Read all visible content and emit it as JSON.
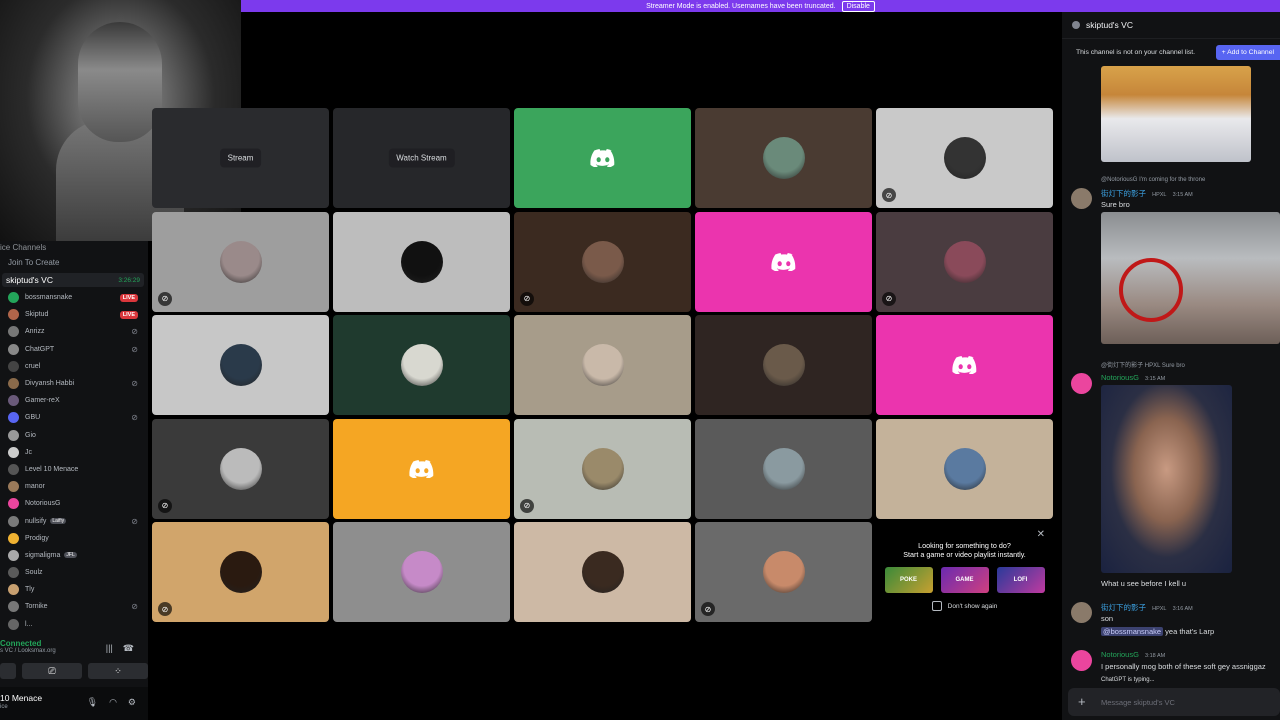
{
  "banner": {
    "text": "Streamer Mode is enabled. Usernames have been truncated.",
    "button": "Disable"
  },
  "sidebar": {
    "header": "ice Channels",
    "join": "Join To Create",
    "channel": {
      "name": "skiptud's VC",
      "timer": "3:26:29"
    },
    "members": [
      {
        "name": "bossmansnake",
        "badge": "LIVE",
        "color": "#23a55a"
      },
      {
        "name": "Skiptud",
        "badge": "LIVE",
        "color": "#b0654a"
      },
      {
        "name": "Anrizz",
        "badge": "",
        "color": "#777777",
        "muted": true
      },
      {
        "name": "ChatGPT",
        "badge": "",
        "color": "#888888",
        "muted": true
      },
      {
        "name": "cruel",
        "badge": "",
        "color": "#444444"
      },
      {
        "name": "Divyansh Habbi",
        "badge": "",
        "color": "#8a6a4a",
        "muted": true
      },
      {
        "name": "Gamer-reX",
        "badge": "",
        "color": "#6a5a7a"
      },
      {
        "name": "GBU",
        "badge": "",
        "color": "#5865f2",
        "muted": true
      },
      {
        "name": "Gio",
        "badge": "",
        "color": "#999999"
      },
      {
        "name": "Jc",
        "badge": "",
        "color": "#cccccc"
      },
      {
        "name": "Level 10 Menace",
        "badge": "",
        "color": "#555555"
      },
      {
        "name": "manor",
        "badge": "",
        "color": "#9a7a5a"
      },
      {
        "name": "NotoriousG",
        "badge": "",
        "color": "#eb459e"
      },
      {
        "name": "nullsify",
        "tag": "Laifiy",
        "badge": "",
        "color": "#7a7a7a",
        "muted": true
      },
      {
        "name": "Prodigy",
        "badge": "",
        "color": "#f0b232"
      },
      {
        "name": "sigmaligma",
        "tag": "JFL",
        "badge": "",
        "color": "#aaaaaa"
      },
      {
        "name": "Soulz",
        "badge": "",
        "color": "#5a5a5a"
      },
      {
        "name": "Tly",
        "badge": "",
        "color": "#c8a070"
      },
      {
        "name": "Tornike",
        "badge": "",
        "color": "#777777",
        "muted": true
      },
      {
        "name": "l...",
        "badge": "",
        "color": "#666666"
      }
    ],
    "connection": {
      "status": "Connected",
      "sub": "s VC / Looksmax.org"
    },
    "user": {
      "name": "10 Menace",
      "status": "ice"
    }
  },
  "tiles": [
    {
      "kind": "stream",
      "label": "Stream",
      "bg": "#2a2b2e",
      "muted": false
    },
    {
      "kind": "stream",
      "label": "Watch Stream",
      "bg": "#26272a",
      "muted": false
    },
    {
      "kind": "logo",
      "bg": "#3ba55c",
      "muted": false
    },
    {
      "kind": "avatar",
      "bg": "#4a3b32",
      "av": "#6a8a7a",
      "muted": false
    },
    {
      "kind": "avatar",
      "bg": "#c9c9c9",
      "av": "#333333",
      "muted": true
    },
    {
      "kind": "avatar",
      "bg": "#9e9e9e",
      "av": "#9a8a8a",
      "muted": true
    },
    {
      "kind": "avatar",
      "bg": "#bdbdbd",
      "av": "#111111",
      "muted": false
    },
    {
      "kind": "avatar",
      "bg": "#3b2a20",
      "av": "#7a5a4a",
      "muted": true
    },
    {
      "kind": "logo",
      "bg": "#eb34ae",
      "muted": false
    },
    {
      "kind": "avatar",
      "bg": "#4a3c40",
      "av": "#8a4a5a",
      "muted": true
    },
    {
      "kind": "avatar",
      "bg": "#c7c7c7",
      "av": "#2a3a4a",
      "muted": false
    },
    {
      "kind": "avatar",
      "bg": "#1f3a2e",
      "av": "#d8d8d0",
      "muted": false
    },
    {
      "kind": "avatar",
      "bg": "#a79c8a",
      "av": "#c9b9a9",
      "muted": false
    },
    {
      "kind": "avatar",
      "bg": "#2f2522",
      "av": "#6a5a4a",
      "muted": false
    },
    {
      "kind": "logo",
      "bg": "#eb34ae",
      "muted": false
    },
    {
      "kind": "avatar",
      "bg": "#3a3a3a",
      "av": "#bbbbbb",
      "muted": true
    },
    {
      "kind": "logo",
      "bg": "#f5a623",
      "muted": false
    },
    {
      "kind": "avatar",
      "bg": "#b8bcb4",
      "av": "#9a8a6a",
      "muted": true
    },
    {
      "kind": "avatar",
      "bg": "#5a5a5a",
      "av": "#8a9aa0",
      "muted": false
    },
    {
      "kind": "avatar",
      "bg": "#c4b29a",
      "av": "#5a7aa0",
      "muted": false
    },
    {
      "kind": "avatar",
      "bg": "#d1a56b",
      "av": "#2a1a10",
      "muted": true
    },
    {
      "kind": "avatar",
      "bg": "#8e8e8e",
      "av": "#c68ac8",
      "muted": false
    },
    {
      "kind": "avatar",
      "bg": "#cdb9a5",
      "av": "#3a2a20",
      "muted": false
    },
    {
      "kind": "avatar",
      "bg": "#6a6a6a",
      "av": "#c88a6a",
      "muted": true
    }
  ],
  "promo": {
    "line1": "Looking for something to do?",
    "line2": "Start a game or video playlist instantly.",
    "thumbs": [
      "POKE",
      "GAME",
      "LOFI"
    ],
    "dont_show": "Don't show again"
  },
  "chat": {
    "title": "skiptud's VC",
    "notice": "This channel is not on your channel list.",
    "add_button": "+ Add to Channel",
    "messages": {
      "reply1": "@NotoriousG I'm coming for the throne",
      "m1_name": "街灯下的影子",
      "m1_tag": "HPXL",
      "m1_time": "3:15 AM",
      "m1_text": "Sure bro",
      "reply2": "@街灯下的影子 HPXL Sure bro",
      "m2_name": "NotoriousG",
      "m2_time": "3:15 AM",
      "m2_caption": "What u see before I kell u",
      "m3_name": "街灯下的影子",
      "m3_tag": "HPXL",
      "m3_time": "3:16 AM",
      "m3_text1": "son",
      "m3_mention": "@bossmansnake",
      "m3_text2": " yea that's Larp",
      "m4_name": "NotoriousG",
      "m4_time": "3:18 AM",
      "m4_text": "I personally mog both of these soft gey assniggaz"
    },
    "typing": "ChatGPT is typing...",
    "placeholder": "Message skiptud's VC"
  },
  "colors": {
    "accent": "#5865f2",
    "online": "#23a55a",
    "banner": "#7c3aed"
  }
}
